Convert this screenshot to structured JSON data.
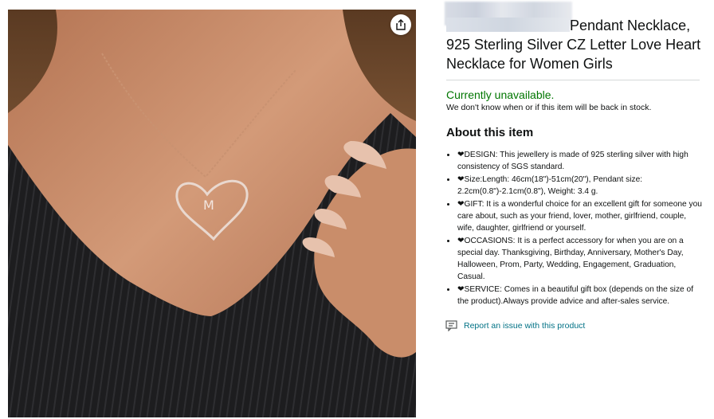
{
  "product": {
    "title": "Pendant Necklace, 925 Sterling Silver CZ Letter Love Heart Necklace for Women Girls"
  },
  "availability": {
    "status": "Currently unavailable.",
    "note": "We don't know when or if this item will be back in stock."
  },
  "about": {
    "heading": "About this item",
    "bullets": [
      "❤DESIGN: This jewellery is made of 925 sterling silver with high consistency of SGS standard.",
      "❤Size:Length: 46cm(18\")-51cm(20\"), Pendant size: 2.2cm(0.8\")-2.1cm(0.8\"), Weight: 3.4 g.",
      "❤GIFT: It is a wonderful choice for an excellent gift for someone you care about, such as your friend, lover, mother, girlfriend, couple, wife, daughter, girlfriend or yourself.",
      "❤OCCASIONS: It is a perfect accessory for when you are on a special day. Thanksgiving, Birthday, Anniversary, Mother's Day, Halloween, Prom, Party, Wedding, Engagement, Graduation, Casual.",
      "❤SERVICE: Comes in a beautiful gift box (depends on the size of the product).Always provide advice and after-sales service."
    ]
  },
  "report_link": "Report an issue with this product",
  "image": {
    "pendant_letter": "M",
    "icons": {
      "share": "share-icon",
      "report": "report-issue-icon"
    }
  },
  "colors": {
    "availability_green": "#007600",
    "link_teal": "#007185",
    "text": "#0f1111"
  }
}
